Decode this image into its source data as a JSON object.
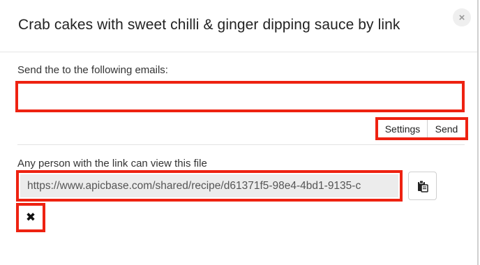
{
  "modal": {
    "title": "Crab cakes with sweet chilli & ginger dipping sauce by link",
    "close_icon": "×"
  },
  "email_section": {
    "label": "Send the to the following emails:",
    "input_value": "",
    "settings_label": "Settings",
    "send_label": "Send"
  },
  "link_section": {
    "label": "Any person with the link can view this file",
    "url": "https://www.apicbase.com/shared/recipe/d61371f5-98e4-4bd1-9135-c",
    "copy_icon": "clipboard-icon",
    "remove_icon": "✖"
  },
  "colors": {
    "highlight": "#ee2211",
    "readonly_bg": "#ececec"
  }
}
